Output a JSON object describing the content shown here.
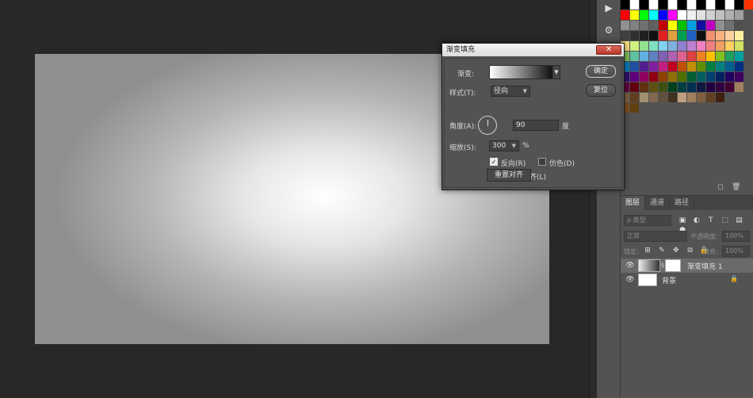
{
  "dialog": {
    "title": "渐变填充",
    "close_symbol": "✕",
    "gradient_label": "渐变:",
    "style_label": "样式(T):",
    "style_value": "径向",
    "angle_label": "角度(A):",
    "angle_value": "90",
    "angle_unit": "度",
    "scale_label": "缩放(S):",
    "scale_value": "300",
    "scale_unit": "%",
    "reverse_label": "反向(R)",
    "dither_label": "仿色(D)",
    "align_label": "与图层对齐(L)",
    "reset_align_label": "重置对齐",
    "ok_label": "确定",
    "reset_label": "复位",
    "checkmark": "✓"
  },
  "layers_panel": {
    "tabs": [
      "图层",
      "通道",
      "路径"
    ],
    "kind_filter_placeholder": "ρ 类型",
    "blend_mode": "正常",
    "opacity_label": "不透明度:",
    "opacity_value": "100%",
    "lock_label": "锁定:",
    "fill_label": "填充:",
    "fill_value": "100%",
    "layers": [
      {
        "name": "渐变填充 1"
      },
      {
        "name": "背景"
      }
    ]
  },
  "swatch_colors": [
    [
      "#000000",
      "#ffffff",
      "#000000",
      "#ffffff",
      "#000000",
      "#ffffff",
      "#000000",
      "#ffffff",
      "#000000",
      "#ffffff",
      "#000000",
      "#ffffff",
      "#000000",
      "#ff3300"
    ],
    [
      "#ff0000",
      "#ffff00",
      "#00ff00",
      "#00ffff",
      "#0000ff",
      "#ff00ff",
      "#ffffff",
      "#f0f0f0",
      "#e0e0e0",
      "#d0d0d0",
      "#c0c0c0",
      "#b0b0b0",
      "#a0a0a0"
    ],
    [
      "#909090",
      "#808080",
      "#707070",
      "#606060",
      "#c00000",
      "#ffff00",
      "#00c000",
      "#00a0e0",
      "#1010a0",
      "#c000c0",
      "#909090",
      "#707070",
      "#505050"
    ],
    [
      "#404040",
      "#303030",
      "#202020",
      "#101010",
      "#e02020",
      "#e0a040",
      "#00a050",
      "#2060c0",
      "#101010",
      "#f09070",
      "#f8b080",
      "#ffd0a0",
      "#fff0a0"
    ],
    [
      "#ffe080",
      "#d0f080",
      "#90e090",
      "#80e0c0",
      "#80d0f0",
      "#80b0e0",
      "#9080d0",
      "#c080d0",
      "#f080c0",
      "#f08080",
      "#f0a060",
      "#ffd060",
      "#d0e060"
    ],
    [
      "#80c060",
      "#60c0a0",
      "#60b0e0",
      "#6080c0",
      "#8060b0",
      "#b060b0",
      "#e06090",
      "#e04040",
      "#f08020",
      "#ffc000",
      "#80c020",
      "#20a060",
      "#00a0a0"
    ],
    [
      "#0080c0",
      "#2050a0",
      "#502090",
      "#8020a0",
      "#c02080",
      "#c00020",
      "#c05000",
      "#c09000",
      "#609000",
      "#008040",
      "#008080",
      "#006090",
      "#003080"
    ],
    [
      "#301070",
      "#600080",
      "#900060",
      "#900010",
      "#904000",
      "#907000",
      "#507000",
      "#006030",
      "#006060",
      "#004070",
      "#002060",
      "#200060",
      "#400060"
    ],
    [
      "#600040",
      "#600010",
      "#603010",
      "#605010",
      "#405010",
      "#004020",
      "#004040",
      "#003050",
      "#101840",
      "#200040",
      "#300040",
      "#400030",
      "#a08060"
    ],
    [
      "#806040",
      "#604020",
      "#a09070",
      "#806850",
      "#605040",
      "#403020",
      "#c0a080",
      "#a08060",
      "#806040",
      "#604020",
      "#402010"
    ],
    [
      "#805020",
      "#604010"
    ]
  ]
}
